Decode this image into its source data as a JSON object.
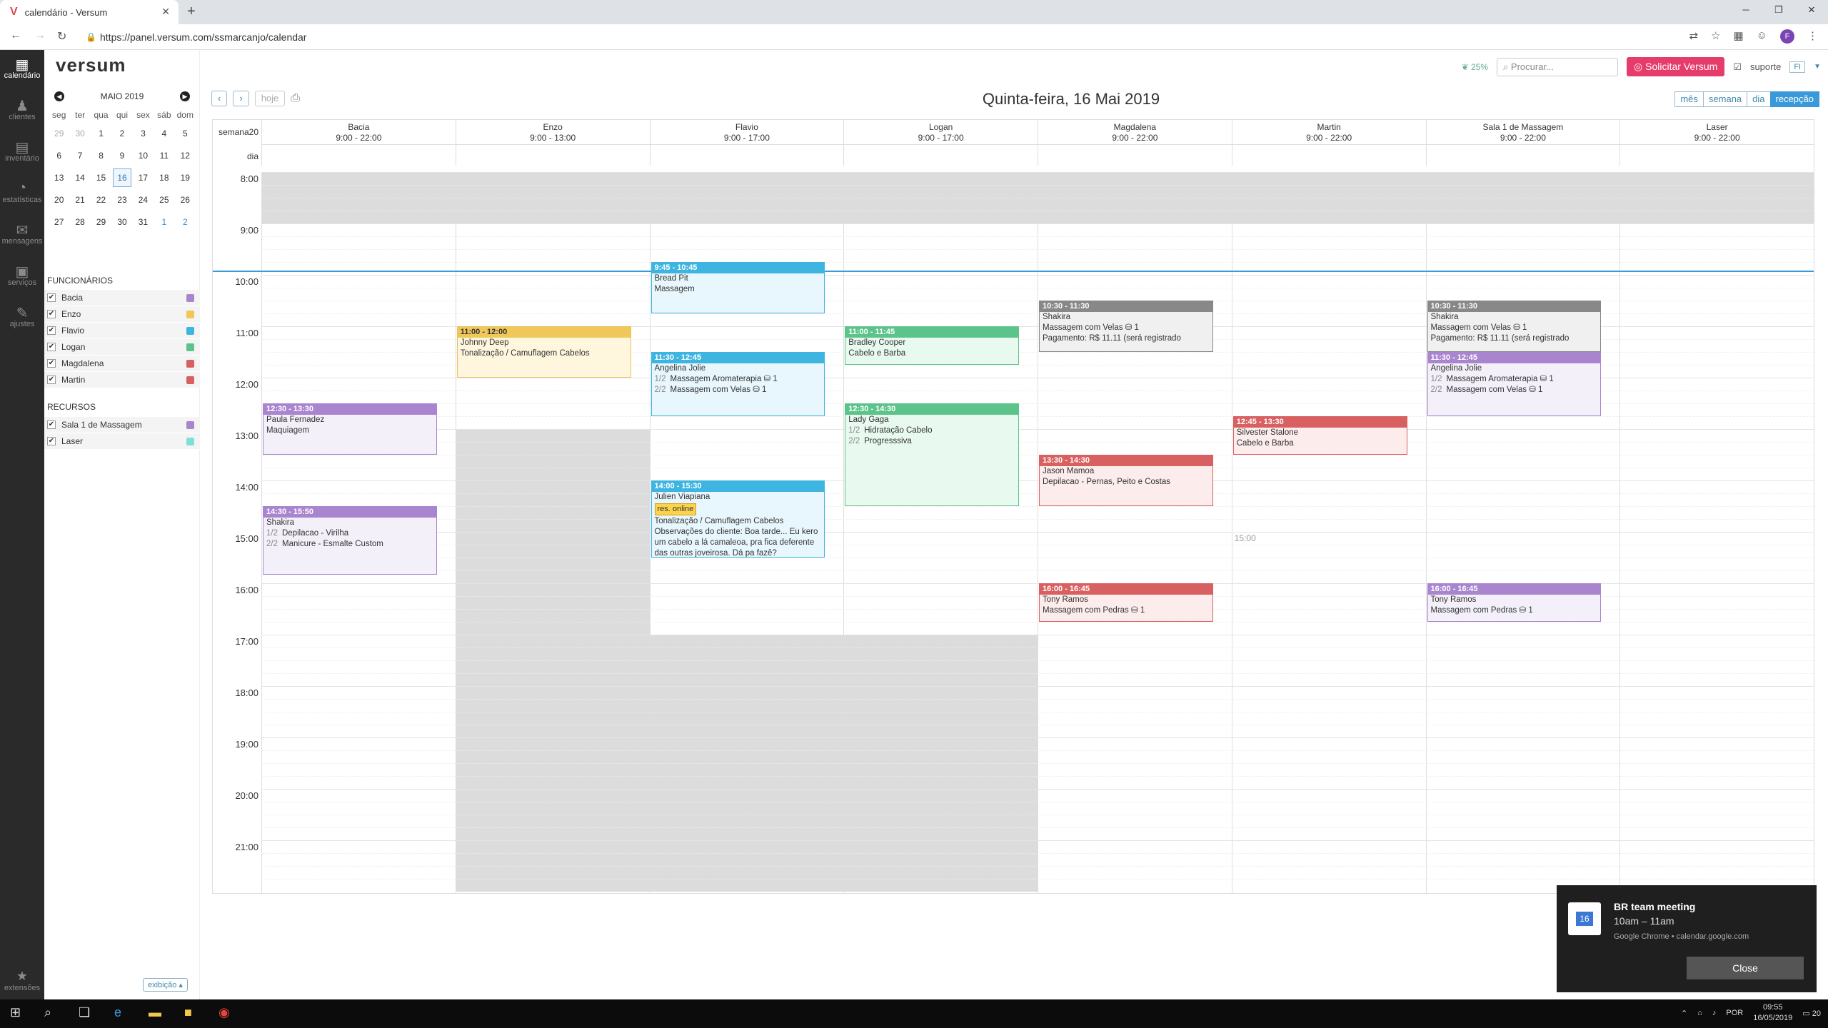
{
  "browser": {
    "tab_title": "calendário - Versum",
    "url": "https://panel.versum.com/ssmarcanjo/calendar",
    "favicon": "V",
    "new_tab": "+",
    "profile": "F"
  },
  "leftnav": [
    {
      "name": "calendario",
      "label": "calendário",
      "icon": "calendar-icon"
    },
    {
      "name": "clientes",
      "label": "clientes",
      "icon": "people-icon"
    },
    {
      "name": "inventario",
      "label": "inventário",
      "icon": "box-icon"
    },
    {
      "name": "estatisticas",
      "label": "estatísticas",
      "icon": "chart-icon"
    },
    {
      "name": "mensagens",
      "label": "mensagens",
      "icon": "chat-icon"
    },
    {
      "name": "servicos",
      "label": "serviços",
      "icon": "clipboard-icon"
    },
    {
      "name": "ajustes",
      "label": "ajustes",
      "icon": "wrench-icon"
    }
  ],
  "leftnav_bottom": "extensões",
  "logo": "versum",
  "minical": {
    "title": "MAIO 2019",
    "dows": [
      "seg",
      "ter",
      "qua",
      "qui",
      "sex",
      "sáb",
      "dom"
    ],
    "weeks": [
      [
        "29",
        "30",
        "1",
        "2",
        "3",
        "4",
        "5"
      ],
      [
        "6",
        "7",
        "8",
        "9",
        "10",
        "11",
        "12"
      ],
      [
        "13",
        "14",
        "15",
        "16",
        "17",
        "18",
        "19"
      ],
      [
        "20",
        "21",
        "22",
        "23",
        "24",
        "25",
        "26"
      ],
      [
        "27",
        "28",
        "29",
        "30",
        "31",
        "1",
        "2"
      ]
    ]
  },
  "funcionarios_title": "FUNCIONÁRIOS",
  "funcionarios": [
    {
      "label": "Bacia",
      "color": "#a985cf"
    },
    {
      "label": "Enzo",
      "color": "#f0c85a"
    },
    {
      "label": "Flavio",
      "color": "#3db5e0"
    },
    {
      "label": "Logan",
      "color": "#5cc48a"
    },
    {
      "label": "Magdalena",
      "color": "#d96060"
    },
    {
      "label": "Martin",
      "color": "#d96060"
    }
  ],
  "recursos_title": "RECURSOS",
  "recursos": [
    {
      "label": "Sala 1 de Massagem",
      "color": "#a985cf"
    },
    {
      "label": "Laser",
      "color": "#7fe0d6"
    }
  ],
  "exibicao": "exibição ▴",
  "top": {
    "pct": "25%",
    "search_placeholder": "Procurar...",
    "solicitar": "Solicitar Versum",
    "suporte": "suporte",
    "user": "FI"
  },
  "controls": {
    "prev": "‹",
    "next": "›",
    "hoje": "hoje"
  },
  "day_title": "Quinta-feira, 16 Mai 2019",
  "views": [
    "mês",
    "semana",
    "dia",
    "recepção"
  ],
  "week_label": "semana20",
  "dia_label": "dia",
  "columns": [
    {
      "name": "Bacia",
      "hours": "9:00 - 22:00"
    },
    {
      "name": "Enzo",
      "hours": "9:00 - 13:00"
    },
    {
      "name": "Flavio",
      "hours": "9:00 - 17:00"
    },
    {
      "name": "Logan",
      "hours": "9:00 - 17:00"
    },
    {
      "name": "Magdalena",
      "hours": "9:00 - 22:00"
    },
    {
      "name": "Martin",
      "hours": "9:00 - 22:00"
    },
    {
      "name": "Sala 1 de Massagem",
      "hours": "9:00 - 22:00"
    },
    {
      "name": "Laser",
      "hours": "9:00 - 22:00"
    }
  ],
  "hours": [
    "8:00",
    "9:00",
    "10:00",
    "11:00",
    "12:00",
    "13:00",
    "14:00",
    "15:00",
    "16:00",
    "17:00",
    "18:00",
    "19:00",
    "20:00",
    "21:00"
  ],
  "now_time": "09:55",
  "martin_marker": "15:00",
  "events": [
    {
      "col": 0,
      "start": "12:30",
      "end": "13:30",
      "cls": "c-bacia",
      "time": "12:30 - 13:30",
      "lines": [
        {
          "t": "Paula Fernadez"
        },
        {
          "t": "Maquiagem"
        }
      ]
    },
    {
      "col": 0,
      "start": "14:30",
      "end": "15:50",
      "cls": "c-bacia",
      "time": "14:30 - 15:50",
      "lines": [
        {
          "t": "Shakira"
        },
        {
          "s": "1/2",
          "t": "Depilacao - Virilha"
        },
        {
          "s": "2/2",
          "t": "Manicure - Esmalte Custom"
        }
      ]
    },
    {
      "col": 1,
      "start": "11:00",
      "end": "12:00",
      "cls": "c-enzo",
      "time": "11:00 - 12:00",
      "lines": [
        {
          "t": "Johnny Deep"
        },
        {
          "t": "Tonalização / Camuflagem Cabelos"
        }
      ]
    },
    {
      "col": 2,
      "start": "9:45",
      "end": "10:45",
      "cls": "c-flavio",
      "time": "9:45 - 10:45",
      "lines": [
        {
          "t": "Bread Pit"
        },
        {
          "t": "Massagem"
        }
      ]
    },
    {
      "col": 2,
      "start": "11:30",
      "end": "12:45",
      "cls": "c-flavio",
      "time": "11:30 - 12:45",
      "lines": [
        {
          "t": "Angelina Jolie"
        },
        {
          "s": "1/2",
          "t": "Massagem Aromaterapia",
          "r": "1"
        },
        {
          "s": "2/2",
          "t": "Massagem com Velas",
          "r": "1"
        }
      ]
    },
    {
      "col": 2,
      "start": "14:00",
      "end": "15:30",
      "cls": "c-flavio",
      "time": "14:00 - 15:30",
      "lines": [
        {
          "t": "Julien Viapiana"
        },
        {
          "badge": "res. online"
        },
        {
          "t": "Tonalização / Camuflagem Cabelos"
        },
        {
          "note": "Observações do cliente: Boa tarde... Eu kero um cabelo a lá camaleoa, pra fica deferente das outras joveirosa. Dá pa fazê?"
        }
      ]
    },
    {
      "col": 3,
      "start": "11:00",
      "end": "11:45",
      "cls": "c-logan",
      "time": "11:00 - 11:45",
      "lines": [
        {
          "t": "Bradley Cooper"
        },
        {
          "t": "Cabelo e Barba"
        }
      ]
    },
    {
      "col": 3,
      "start": "12:30",
      "end": "14:30",
      "cls": "c-logan",
      "time": "12:30 - 14:30",
      "lines": [
        {
          "t": "Lady Gaga"
        },
        {
          "s": "1/2",
          "t": "Hidratação Cabelo"
        },
        {
          "s": "2/2",
          "t": "Progresssiva"
        }
      ]
    },
    {
      "col": 4,
      "start": "10:30",
      "end": "11:30",
      "cls": "c-gray",
      "time": "10:30 - 11:30",
      "lines": [
        {
          "t": "Shakira"
        },
        {
          "t": "Massagem com Velas",
          "r": "1"
        },
        {
          "t": ""
        },
        {
          "t": "Pagamento: R$ 11.11 (será registrado"
        }
      ]
    },
    {
      "col": 4,
      "start": "13:30",
      "end": "14:30",
      "cls": "c-mag",
      "time": "13:30 - 14:30",
      "lines": [
        {
          "t": "Jason Mamoa"
        },
        {
          "t": "Depilacao - Pernas, Peito e Costas"
        }
      ]
    },
    {
      "col": 4,
      "start": "16:00",
      "end": "16:45",
      "cls": "c-mag",
      "time": "16:00 - 16:45",
      "lines": [
        {
          "t": "Tony Ramos"
        },
        {
          "t": "Massagem com Pedras",
          "r": "1"
        }
      ]
    },
    {
      "col": 5,
      "start": "12:45",
      "end": "13:30",
      "cls": "c-martin",
      "time": "12:45 - 13:30",
      "lines": [
        {
          "t": "Silvester Stalone"
        },
        {
          "t": "Cabelo e Barba"
        }
      ]
    },
    {
      "col": 6,
      "start": "10:30",
      "end": "11:30",
      "cls": "c-gray",
      "time": "10:30 - 11:30",
      "lines": [
        {
          "t": "Shakira"
        },
        {
          "t": "Massagem com Velas",
          "r": "1"
        },
        {
          "t": ""
        },
        {
          "t": "Pagamento: R$ 11.11 (será registrado"
        }
      ]
    },
    {
      "col": 6,
      "start": "11:30",
      "end": "12:45",
      "cls": "c-bacia",
      "time": "11:30 - 12:45",
      "lines": [
        {
          "t": "Angelina Jolie"
        },
        {
          "s": "1/2",
          "t": "Massagem Aromaterapia",
          "r": "1"
        },
        {
          "s": "2/2",
          "t": "Massagem com Velas",
          "r": "1"
        }
      ]
    },
    {
      "col": 6,
      "start": "16:00",
      "end": "16:45",
      "cls": "c-bacia",
      "time": "16:00 - 16:45",
      "lines": [
        {
          "t": "Tony Ramos"
        },
        {
          "t": "Massagem com Pedras",
          "r": "1"
        }
      ]
    }
  ],
  "toast": {
    "title": "BR team meeting",
    "time": "10am – 11am",
    "source": "Google Chrome • calendar.google.com",
    "close": "Close",
    "icon_text": "16"
  },
  "taskbar": {
    "lang": "POR",
    "time": "09:55",
    "date": "16/05/2019",
    "notif": "20"
  }
}
